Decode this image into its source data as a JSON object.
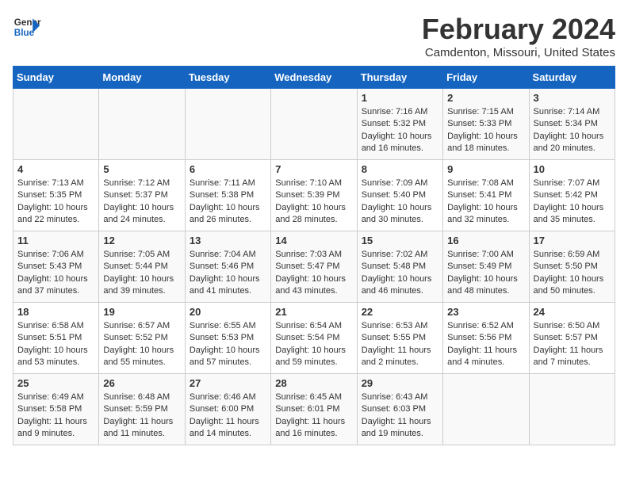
{
  "logo": {
    "line1": "General",
    "line2": "Blue"
  },
  "title": "February 2024",
  "location": "Camdenton, Missouri, United States",
  "days_of_week": [
    "Sunday",
    "Monday",
    "Tuesday",
    "Wednesday",
    "Thursday",
    "Friday",
    "Saturday"
  ],
  "weeks": [
    [
      {
        "day": "",
        "info": ""
      },
      {
        "day": "",
        "info": ""
      },
      {
        "day": "",
        "info": ""
      },
      {
        "day": "",
        "info": ""
      },
      {
        "day": "1",
        "info": "Sunrise: 7:16 AM\nSunset: 5:32 PM\nDaylight: 10 hours\nand 16 minutes."
      },
      {
        "day": "2",
        "info": "Sunrise: 7:15 AM\nSunset: 5:33 PM\nDaylight: 10 hours\nand 18 minutes."
      },
      {
        "day": "3",
        "info": "Sunrise: 7:14 AM\nSunset: 5:34 PM\nDaylight: 10 hours\nand 20 minutes."
      }
    ],
    [
      {
        "day": "4",
        "info": "Sunrise: 7:13 AM\nSunset: 5:35 PM\nDaylight: 10 hours\nand 22 minutes."
      },
      {
        "day": "5",
        "info": "Sunrise: 7:12 AM\nSunset: 5:37 PM\nDaylight: 10 hours\nand 24 minutes."
      },
      {
        "day": "6",
        "info": "Sunrise: 7:11 AM\nSunset: 5:38 PM\nDaylight: 10 hours\nand 26 minutes."
      },
      {
        "day": "7",
        "info": "Sunrise: 7:10 AM\nSunset: 5:39 PM\nDaylight: 10 hours\nand 28 minutes."
      },
      {
        "day": "8",
        "info": "Sunrise: 7:09 AM\nSunset: 5:40 PM\nDaylight: 10 hours\nand 30 minutes."
      },
      {
        "day": "9",
        "info": "Sunrise: 7:08 AM\nSunset: 5:41 PM\nDaylight: 10 hours\nand 32 minutes."
      },
      {
        "day": "10",
        "info": "Sunrise: 7:07 AM\nSunset: 5:42 PM\nDaylight: 10 hours\nand 35 minutes."
      }
    ],
    [
      {
        "day": "11",
        "info": "Sunrise: 7:06 AM\nSunset: 5:43 PM\nDaylight: 10 hours\nand 37 minutes."
      },
      {
        "day": "12",
        "info": "Sunrise: 7:05 AM\nSunset: 5:44 PM\nDaylight: 10 hours\nand 39 minutes."
      },
      {
        "day": "13",
        "info": "Sunrise: 7:04 AM\nSunset: 5:46 PM\nDaylight: 10 hours\nand 41 minutes."
      },
      {
        "day": "14",
        "info": "Sunrise: 7:03 AM\nSunset: 5:47 PM\nDaylight: 10 hours\nand 43 minutes."
      },
      {
        "day": "15",
        "info": "Sunrise: 7:02 AM\nSunset: 5:48 PM\nDaylight: 10 hours\nand 46 minutes."
      },
      {
        "day": "16",
        "info": "Sunrise: 7:00 AM\nSunset: 5:49 PM\nDaylight: 10 hours\nand 48 minutes."
      },
      {
        "day": "17",
        "info": "Sunrise: 6:59 AM\nSunset: 5:50 PM\nDaylight: 10 hours\nand 50 minutes."
      }
    ],
    [
      {
        "day": "18",
        "info": "Sunrise: 6:58 AM\nSunset: 5:51 PM\nDaylight: 10 hours\nand 53 minutes."
      },
      {
        "day": "19",
        "info": "Sunrise: 6:57 AM\nSunset: 5:52 PM\nDaylight: 10 hours\nand 55 minutes."
      },
      {
        "day": "20",
        "info": "Sunrise: 6:55 AM\nSunset: 5:53 PM\nDaylight: 10 hours\nand 57 minutes."
      },
      {
        "day": "21",
        "info": "Sunrise: 6:54 AM\nSunset: 5:54 PM\nDaylight: 10 hours\nand 59 minutes."
      },
      {
        "day": "22",
        "info": "Sunrise: 6:53 AM\nSunset: 5:55 PM\nDaylight: 11 hours\nand 2 minutes."
      },
      {
        "day": "23",
        "info": "Sunrise: 6:52 AM\nSunset: 5:56 PM\nDaylight: 11 hours\nand 4 minutes."
      },
      {
        "day": "24",
        "info": "Sunrise: 6:50 AM\nSunset: 5:57 PM\nDaylight: 11 hours\nand 7 minutes."
      }
    ],
    [
      {
        "day": "25",
        "info": "Sunrise: 6:49 AM\nSunset: 5:58 PM\nDaylight: 11 hours\nand 9 minutes."
      },
      {
        "day": "26",
        "info": "Sunrise: 6:48 AM\nSunset: 5:59 PM\nDaylight: 11 hours\nand 11 minutes."
      },
      {
        "day": "27",
        "info": "Sunrise: 6:46 AM\nSunset: 6:00 PM\nDaylight: 11 hours\nand 14 minutes."
      },
      {
        "day": "28",
        "info": "Sunrise: 6:45 AM\nSunset: 6:01 PM\nDaylight: 11 hours\nand 16 minutes."
      },
      {
        "day": "29",
        "info": "Sunrise: 6:43 AM\nSunset: 6:03 PM\nDaylight: 11 hours\nand 19 minutes."
      },
      {
        "day": "",
        "info": ""
      },
      {
        "day": "",
        "info": ""
      }
    ]
  ]
}
